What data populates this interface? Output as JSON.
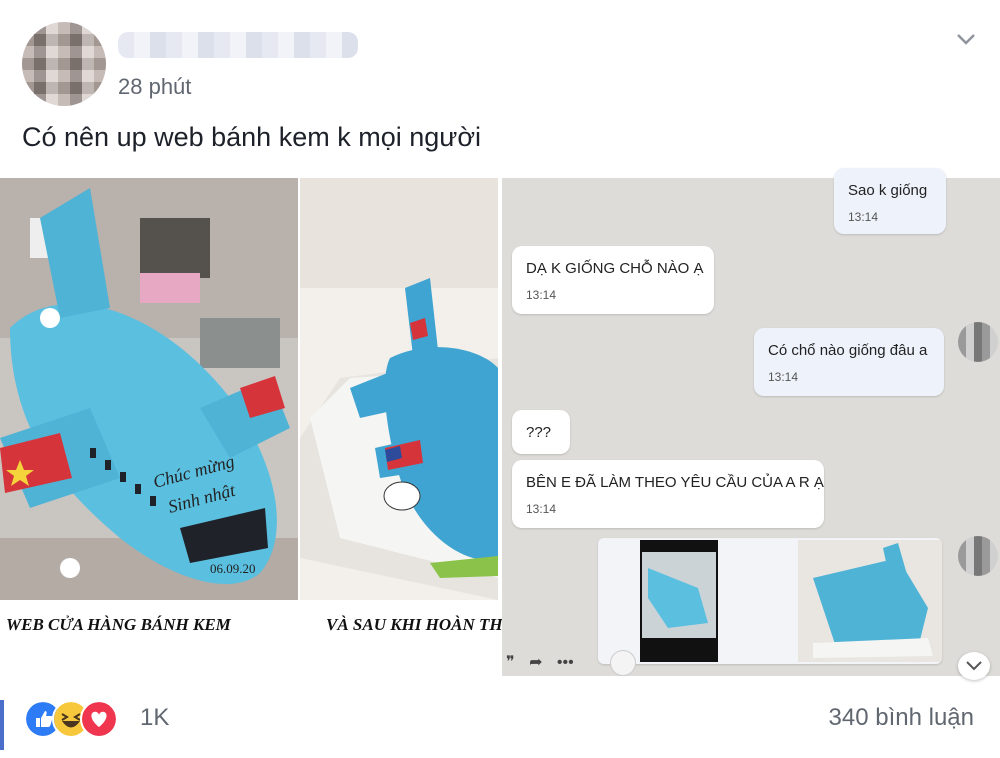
{
  "post": {
    "timestamp": "28 phút",
    "text": "Có nên up web bánh kem k mọi người"
  },
  "photos": {
    "left": {
      "caption_left": "WEB CỬA HÀNG BÁNH KEM",
      "caption_right": "VÀ SAU KHI HOÀN TH",
      "cake_writing": "06.09.20"
    },
    "right": {
      "messages": [
        {
          "text": "Sao k giống",
          "time": "13:14",
          "side": "right"
        },
        {
          "text": "DẠ K GIỐNG CHỖ NÀO Ạ",
          "time": "13:14",
          "side": "left"
        },
        {
          "text": "Có chổ nào giống đâu a",
          "time": "13:14",
          "side": "right"
        },
        {
          "text": "???",
          "side": "left"
        },
        {
          "text": "BÊN E ĐÃ LÀM THEO YÊU CẦU CỦA A R Ạ",
          "time": "13:14",
          "side": "left"
        }
      ]
    }
  },
  "footer": {
    "reaction_count": "1K",
    "comment_count": "340 bình luận",
    "reactions": [
      "like-icon",
      "haha-icon",
      "love-icon"
    ]
  },
  "colors": {
    "accent": "#4a6ec9",
    "like": "#2e7bf6",
    "love": "#f0354f",
    "haha": "#f7c83b",
    "cake": "#5bbfe0"
  }
}
